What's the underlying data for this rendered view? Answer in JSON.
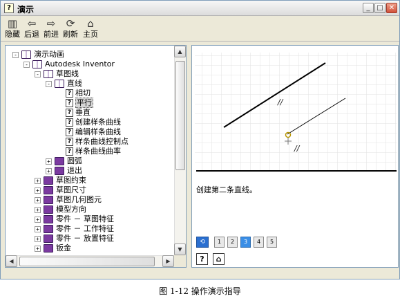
{
  "window": {
    "title": "演示",
    "title_icon": "?"
  },
  "toolbar": [
    {
      "icon": "hide-icon",
      "glyph": "▥",
      "label": "隐藏"
    },
    {
      "icon": "back-arrow-icon",
      "glyph": "⇦",
      "label": "后退"
    },
    {
      "icon": "forward-arrow-icon",
      "glyph": "⇨",
      "label": "前进"
    },
    {
      "icon": "refresh-icon",
      "glyph": "⟳",
      "label": "刷新"
    },
    {
      "icon": "home-icon",
      "glyph": "⌂",
      "label": "主页"
    }
  ],
  "tree": [
    {
      "text": "演示动画",
      "type": "book-open",
      "expander": "-"
    },
    {
      "text": "Autodesk Inventor",
      "type": "book-open",
      "expander": "-"
    },
    {
      "text": "草图线",
      "type": "book-open",
      "expander": "-"
    },
    {
      "text": "直线",
      "type": "book-open",
      "expander": "-"
    },
    {
      "text": "相切",
      "type": "page"
    },
    {
      "text": "平行",
      "type": "page",
      "selected": true
    },
    {
      "text": "垂直",
      "type": "page"
    },
    {
      "text": "创建样条曲线",
      "type": "page"
    },
    {
      "text": "编辑样条曲线",
      "type": "page"
    },
    {
      "text": "样条曲线控制点",
      "type": "page"
    },
    {
      "text": "样条曲线曲率",
      "type": "page"
    },
    {
      "text": "圆弧",
      "type": "book",
      "expander": "+"
    },
    {
      "text": "退出",
      "type": "book",
      "expander": "+"
    },
    {
      "text": "草图约束",
      "type": "book",
      "expander": "+"
    },
    {
      "text": "草图尺寸",
      "type": "book",
      "expander": "+"
    },
    {
      "text": "草图几何图元",
      "type": "book",
      "expander": "+"
    },
    {
      "text": "模型方向",
      "type": "book",
      "expander": "+"
    },
    {
      "text": "零件 － 草图特征",
      "type": "book",
      "expander": "+"
    },
    {
      "text": "零件 － 工作特征",
      "type": "book",
      "expander": "+"
    },
    {
      "text": "零件 － 放置特征",
      "type": "book",
      "expander": "+"
    },
    {
      "text": "钣金",
      "type": "book",
      "expander": "+"
    }
  ],
  "demo": {
    "caption": "创建第二条直线。",
    "parallel_mark_1": "//",
    "parallel_mark_2": "//",
    "steps": [
      "1",
      "2",
      "3",
      "4",
      "5"
    ],
    "active_step": "3"
  },
  "bottom_icons": {
    "help_glyph": "?",
    "home_glyph": "⌂"
  },
  "figure_caption": "图 1-12  操作演示指导",
  "colors": {
    "accent": "#3a8ee6",
    "book": "#7b3aa0"
  }
}
